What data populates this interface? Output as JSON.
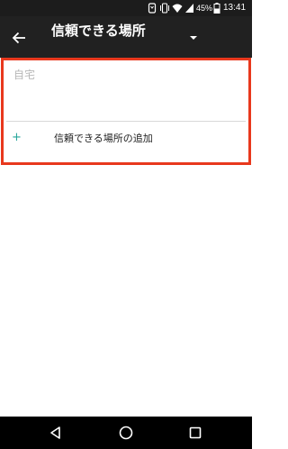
{
  "status_bar": {
    "battery_percent": "45%",
    "time": "13:41",
    "icons": [
      "nfc-icon",
      "vibrate-icon",
      "wifi-icon",
      "cellular-signal-icon",
      "battery-icon"
    ]
  },
  "app_bar": {
    "back_icon": "arrow-left-icon",
    "title": "信頼できる場所",
    "dropdown_icon": "caret-down-icon"
  },
  "places": [
    {
      "label": "自宅",
      "state": "disabled"
    }
  ],
  "add_place": {
    "icon": "+",
    "label": "信頼できる場所の追加"
  },
  "navigation_bar": {
    "buttons": [
      "back-triangle-icon",
      "home-circle-icon",
      "recents-square-icon"
    ]
  },
  "colors": {
    "app_bar_bg": "#212121",
    "status_bar_bg": "#1c1c1c",
    "highlight_border": "#e8381d",
    "accent": "#26a69a",
    "disabled_text": "#b7b7b7"
  }
}
